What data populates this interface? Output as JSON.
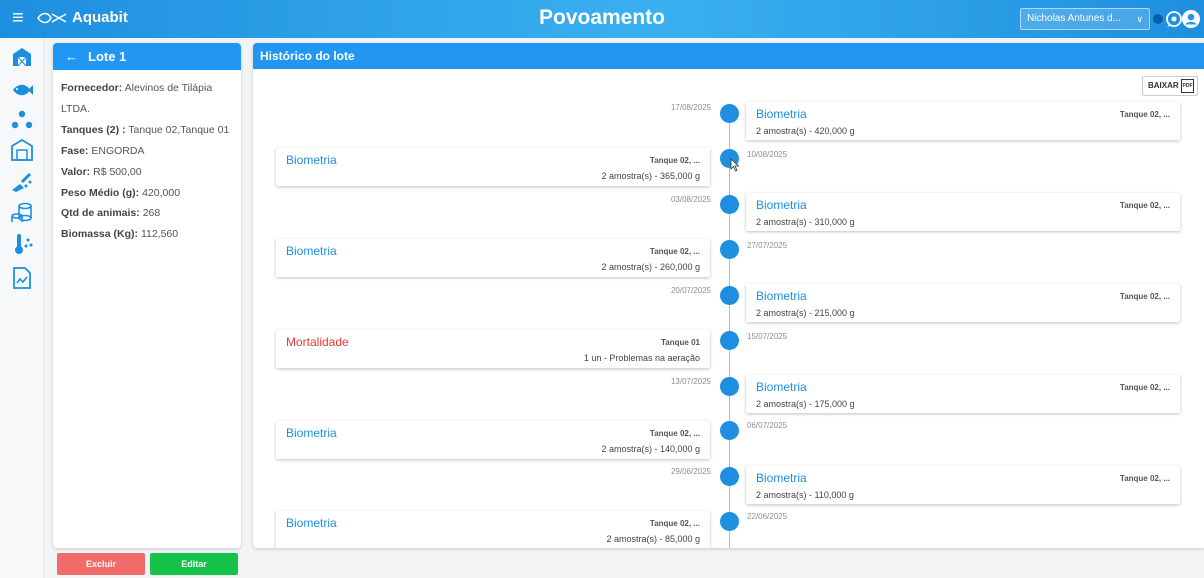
{
  "header": {
    "brand": "Aquabit",
    "title": "Povoamento",
    "user": "Nicholas Antunes d..."
  },
  "colors": {
    "primary": "#2196f3",
    "danger": "#f26b6b",
    "success": "#17c24a",
    "mortalidade": "#e53935"
  },
  "sidebar": {
    "icons": [
      "farm-icon",
      "fish-icon",
      "dots-icon",
      "barn-icon",
      "feed-icon",
      "coins-icon",
      "thermometer-icon",
      "report-icon"
    ]
  },
  "lote": {
    "title": "Lote 1",
    "fields": [
      {
        "label": "Fornecedor:",
        "value": "Alevinos de Tilápia LTDA."
      },
      {
        "label": "Tanques (2) :",
        "value": "Tanque 02,Tanque 01"
      },
      {
        "label": "Fase:",
        "value": "ENGORDA"
      },
      {
        "label": "Valor:",
        "value": "R$ 500,00"
      },
      {
        "label": "Peso Médio (g):",
        "value": "420,000"
      },
      {
        "label": "Qtd de animais:",
        "value": "268"
      },
      {
        "label": "Biomassa (Kg):",
        "value": "112,560"
      }
    ],
    "delete_label": "Excluir",
    "edit_label": "Editar"
  },
  "history": {
    "title": "Histórico do lote",
    "download_label": "BAIXAR",
    "pdf_label": "PDF",
    "events": [
      {
        "date": "17/08/2025",
        "title": "Biometria",
        "tank": "Tanque 02, ...",
        "desc": "2 amostra(s) - 420,000 g",
        "side": "right",
        "type": "biometria"
      },
      {
        "date": "10/08/2025",
        "title": "Biometria",
        "tank": "Tanque 02, ...",
        "desc": "2 amostra(s) - 365,000 g",
        "side": "left",
        "type": "biometria"
      },
      {
        "date": "03/08/2025",
        "title": "Biometria",
        "tank": "Tanque 02, ...",
        "desc": "2 amostra(s) - 310,000 g",
        "side": "right",
        "type": "biometria"
      },
      {
        "date": "27/07/2025",
        "title": "Biometria",
        "tank": "Tanque 02, ...",
        "desc": "2 amostra(s) - 260,000 g",
        "side": "left",
        "type": "biometria"
      },
      {
        "date": "20/07/2025",
        "title": "Biometria",
        "tank": "Tanque 02, ...",
        "desc": "2 amostra(s) - 215,000 g",
        "side": "right",
        "type": "biometria"
      },
      {
        "date": "15/07/2025",
        "title": "Mortalidade",
        "tank": "Tanque 01",
        "desc": "1 un - Problemas na aeração",
        "side": "left",
        "type": "mortalidade"
      },
      {
        "date": "13/07/2025",
        "title": "Biometria",
        "tank": "Tanque 02, ...",
        "desc": "2 amostra(s) - 175,000 g",
        "side": "right",
        "type": "biometria"
      },
      {
        "date": "06/07/2025",
        "title": "Biometria",
        "tank": "Tanque 02, ...",
        "desc": "2 amostra(s) - 140,000 g",
        "side": "left",
        "type": "biometria"
      },
      {
        "date": "29/06/2025",
        "title": "Biometria",
        "tank": "Tanque 02, ...",
        "desc": "2 amostra(s) - 110,000 g",
        "side": "right",
        "type": "biometria"
      },
      {
        "date": "22/06/2025",
        "title": "Biometria",
        "tank": "Tanque 02, ...",
        "desc": "2 amostra(s) - 85,000 g",
        "side": "left",
        "type": "biometria"
      }
    ]
  }
}
